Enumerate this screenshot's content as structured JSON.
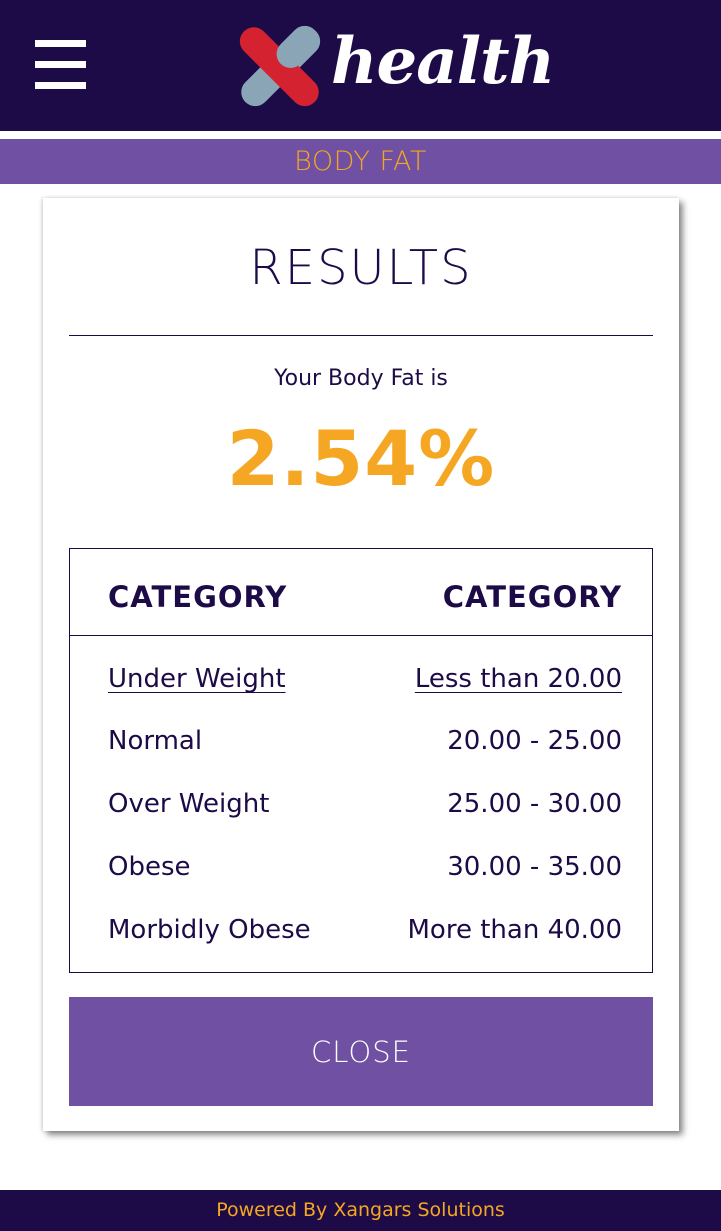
{
  "header": {
    "brand": "health",
    "brand_colors": {
      "mark_red": "#d42230",
      "mark_gray": "#8aa5b5",
      "bar_bg": "#1d0b47"
    }
  },
  "section": {
    "title": "BODY FAT",
    "bar_color": "#6f50a2",
    "accent": "#f5a623"
  },
  "results": {
    "title": "RESULTS",
    "label": "Your Body Fat is",
    "value": "2.54%"
  },
  "table": {
    "headers": [
      "CATEGORY",
      "CATEGORY"
    ],
    "rows": [
      {
        "category": "Under Weight",
        "range": "Less than 20.00"
      },
      {
        "category": "Normal",
        "range": "20.00 - 25.00"
      },
      {
        "category": "Over Weight",
        "range": "25.00 - 30.00"
      },
      {
        "category": "Obese",
        "range": "30.00 - 35.00"
      },
      {
        "category": "Morbidly Obese",
        "range": "More than 40.00"
      }
    ],
    "highlighted_row": 0
  },
  "close_label": "CLOSE",
  "footer": {
    "text": "Powered By Xangars Solutions"
  }
}
